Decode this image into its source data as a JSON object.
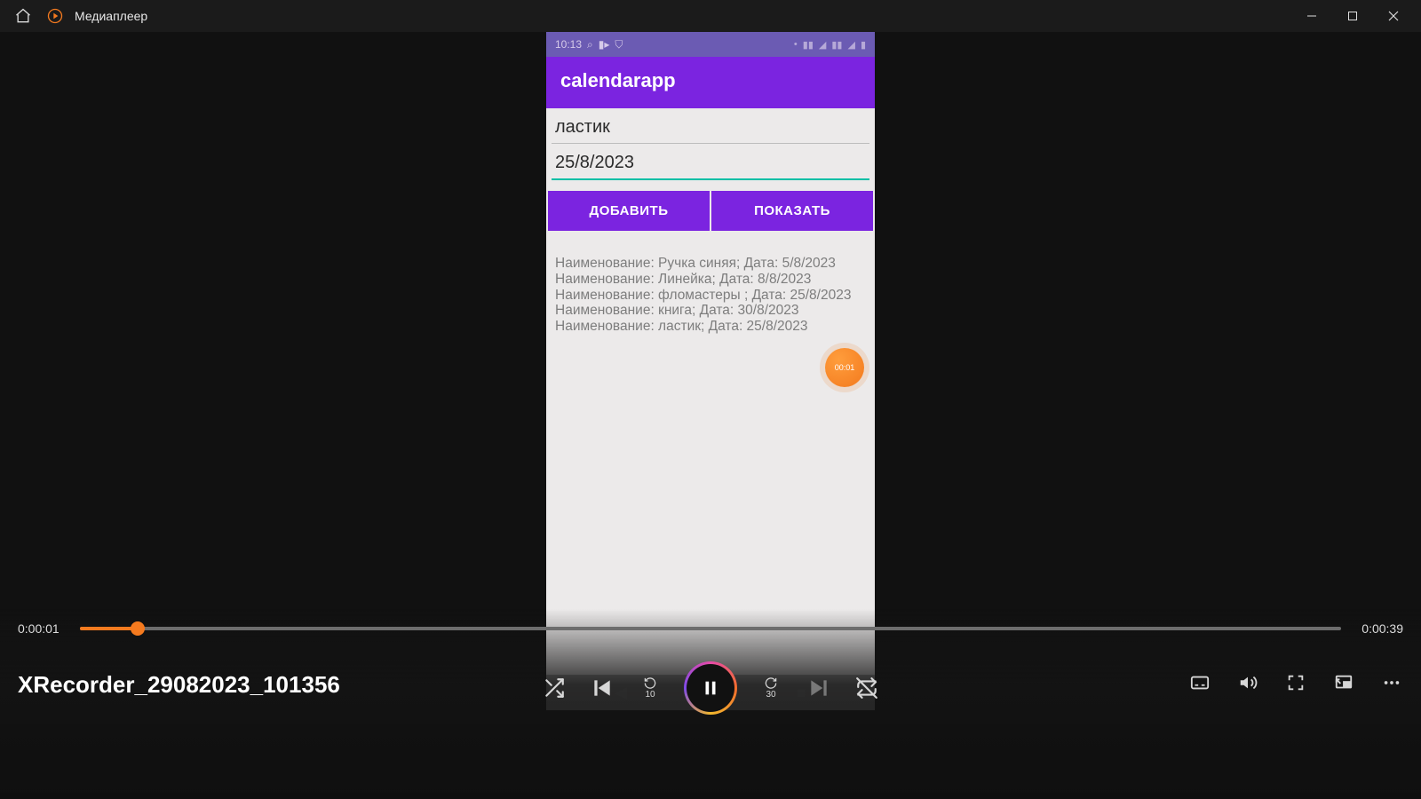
{
  "window": {
    "title": "Медиаплеер"
  },
  "phone": {
    "status_time": "10:13",
    "app_title": "calendarapp",
    "field1": "ластик",
    "field2": "25/8/2023",
    "button_add": "ДОБАВИТЬ",
    "button_show": "ПОКАЗАТЬ",
    "list": [
      "Наименование: Ручка синяя; Дата: 5/8/2023",
      "Наименование: Линейка; Дата: 8/8/2023",
      "Наименование: фломастеры ; Дата: 25/8/2023",
      "Наименование: книга; Дата: 30/8/2023",
      "Наименование: ластик; Дата: 25/8/2023"
    ],
    "rec_badge": "00:01"
  },
  "player": {
    "current_time": "0:00:01",
    "total_time": "0:00:39",
    "file_title": "XRecorder_29082023_101356",
    "back_label": "10",
    "fwd_label": "30"
  }
}
